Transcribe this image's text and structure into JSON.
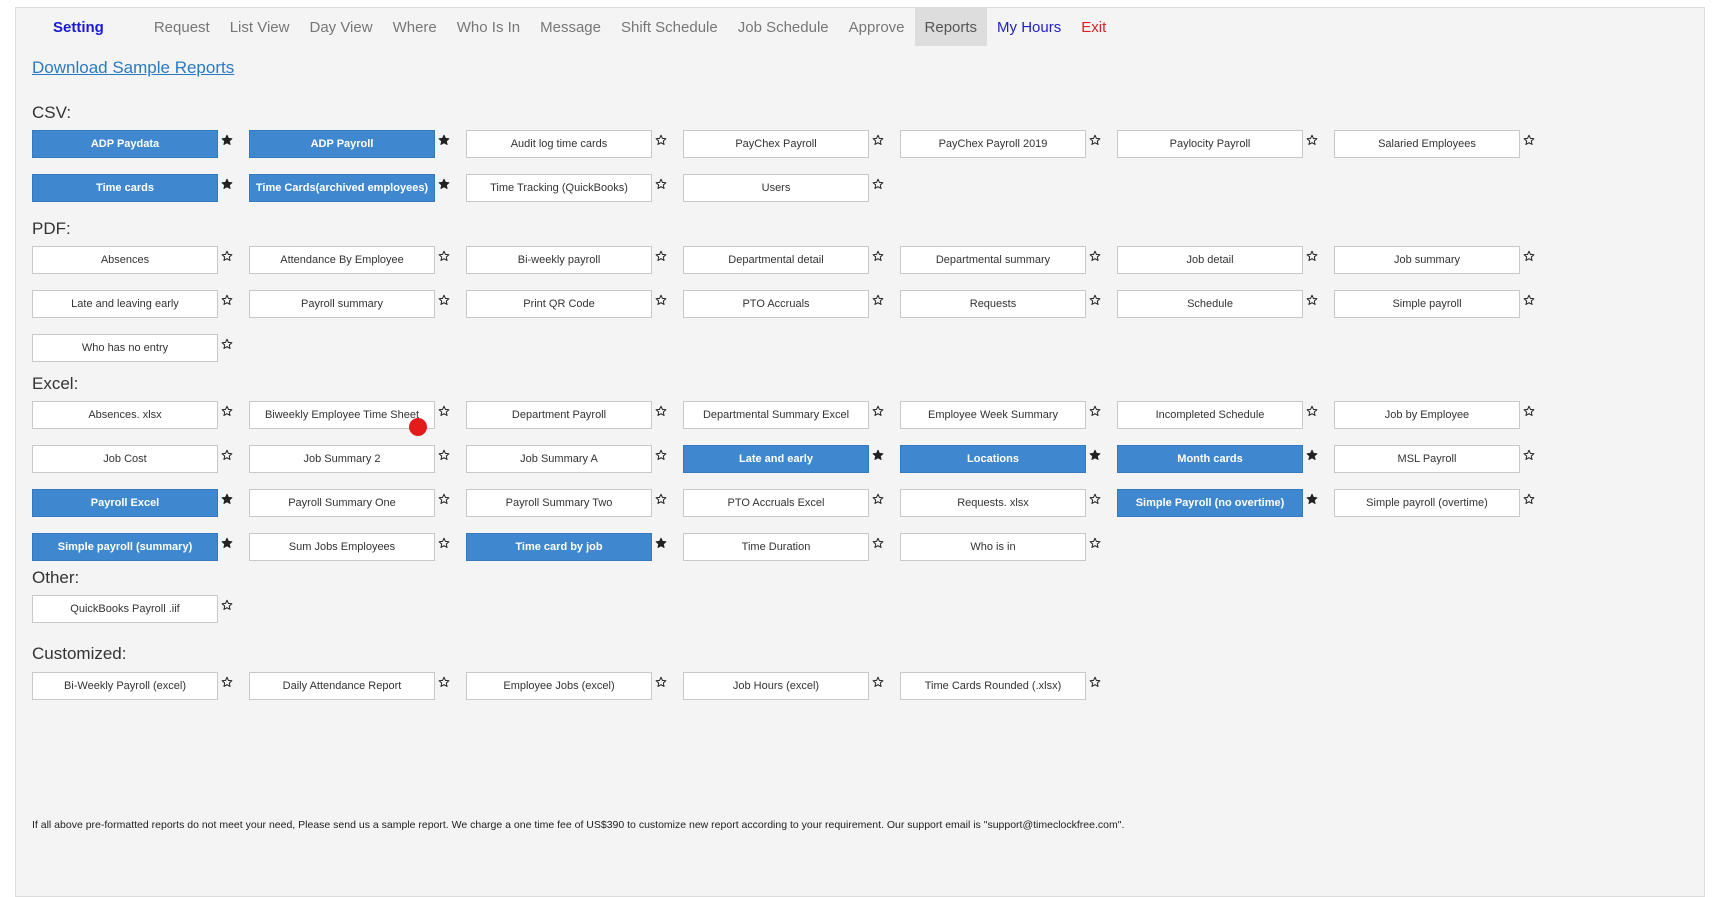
{
  "nav": {
    "brand": "Setting",
    "items": [
      "Request",
      "List View",
      "Day View",
      "Where",
      "Who Is In",
      "Message",
      "Shift Schedule",
      "Job Schedule",
      "Approve",
      "Reports"
    ],
    "my_hours": "My Hours",
    "exit": "Exit",
    "active": "Reports"
  },
  "download_link": "Download Sample Reports",
  "sections": {
    "csv": {
      "title": "CSV:",
      "items": [
        {
          "label": "ADP Paydata",
          "selected": true
        },
        {
          "label": "ADP Payroll",
          "selected": true
        },
        {
          "label": "Audit log time cards",
          "selected": false
        },
        {
          "label": "PayChex Payroll",
          "selected": false
        },
        {
          "label": "PayChex Payroll 2019",
          "selected": false
        },
        {
          "label": "Paylocity Payroll",
          "selected": false
        },
        {
          "label": "Salaried Employees",
          "selected": false
        },
        {
          "label": "Time cards",
          "selected": true
        },
        {
          "label": "Time Cards(archived employees)",
          "selected": true
        },
        {
          "label": "Time Tracking (QuickBooks)",
          "selected": false
        },
        {
          "label": "Users",
          "selected": false
        }
      ]
    },
    "pdf": {
      "title": "PDF:",
      "items": [
        {
          "label": "Absences",
          "selected": false
        },
        {
          "label": "Attendance By Employee",
          "selected": false
        },
        {
          "label": "Bi-weekly payroll",
          "selected": false
        },
        {
          "label": "Departmental detail",
          "selected": false
        },
        {
          "label": "Departmental summary",
          "selected": false
        },
        {
          "label": "Job detail",
          "selected": false
        },
        {
          "label": "Job summary",
          "selected": false
        },
        {
          "label": "Late and leaving early",
          "selected": false
        },
        {
          "label": "Payroll summary",
          "selected": false
        },
        {
          "label": "Print QR Code",
          "selected": false
        },
        {
          "label": "PTO Accruals",
          "selected": false
        },
        {
          "label": "Requests",
          "selected": false
        },
        {
          "label": "Schedule",
          "selected": false
        },
        {
          "label": "Simple payroll",
          "selected": false
        },
        {
          "label": "Who has no entry",
          "selected": false
        }
      ]
    },
    "excel": {
      "title": "Excel:",
      "items": [
        {
          "label": "Absences. xlsx",
          "selected": false
        },
        {
          "label": "Biweekly Employee Time Sheet",
          "selected": false
        },
        {
          "label": "Department Payroll",
          "selected": false
        },
        {
          "label": "Departmental Summary Excel",
          "selected": false
        },
        {
          "label": "Employee Week Summary",
          "selected": false
        },
        {
          "label": "Incompleted Schedule",
          "selected": false
        },
        {
          "label": "Job by Employee",
          "selected": false
        },
        {
          "label": "Job Cost",
          "selected": false
        },
        {
          "label": "Job Summary 2",
          "selected": false
        },
        {
          "label": "Job Summary A",
          "selected": false
        },
        {
          "label": "Late and early",
          "selected": true
        },
        {
          "label": "Locations",
          "selected": true
        },
        {
          "label": "Month cards",
          "selected": true
        },
        {
          "label": "MSL Payroll",
          "selected": false
        },
        {
          "label": "Payroll Excel",
          "selected": true
        },
        {
          "label": "Payroll Summary One",
          "selected": false
        },
        {
          "label": "Payroll Summary Two",
          "selected": false
        },
        {
          "label": "PTO Accruals Excel",
          "selected": false
        },
        {
          "label": "Requests. xlsx",
          "selected": false
        },
        {
          "label": "Simple Payroll (no overtime)",
          "selected": true
        },
        {
          "label": "Simple payroll (overtime)",
          "selected": false
        },
        {
          "label": "Simple payroll (summary)",
          "selected": true
        },
        {
          "label": "Sum Jobs Employees",
          "selected": false
        },
        {
          "label": "Time card by job",
          "selected": true
        },
        {
          "label": "Time Duration",
          "selected": false
        },
        {
          "label": "Who is in",
          "selected": false
        }
      ]
    },
    "other": {
      "title": "Other:",
      "items": [
        {
          "label": "QuickBooks Payroll .iif",
          "selected": false
        }
      ]
    },
    "customized": {
      "title": "Customized:",
      "items": [
        {
          "label": "Bi-Weekly Payroll (excel)",
          "selected": false
        },
        {
          "label": "Daily Attendance Report",
          "selected": false
        },
        {
          "label": "Employee Jobs (excel)",
          "selected": false
        },
        {
          "label": "Job Hours (excel)",
          "selected": false
        },
        {
          "label": "Time Cards Rounded (.xlsx)",
          "selected": false
        }
      ]
    }
  },
  "footer_note": "If all above pre-formatted reports do not meet your need, Please send us a sample report. We charge a one time fee of US$390 to customize new report according to your requirement. Our support email is \"support@timeclockfree.com\".",
  "colors": {
    "selected_button": "#3f88cf",
    "brand": "#1a1ad6",
    "exit": "#e02020",
    "link": "#2a7ac2",
    "marker": "#e31b1b"
  },
  "icons": {
    "favorite": "star-icon",
    "marker": "red-dot-cursor"
  }
}
